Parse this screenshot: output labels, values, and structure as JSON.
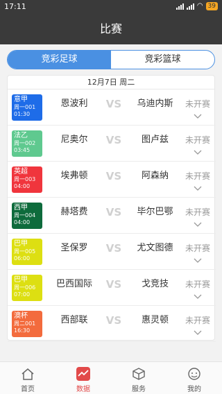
{
  "statusbar": {
    "time": "17:11",
    "battery": "39"
  },
  "header": {
    "title": "比赛"
  },
  "tabs": [
    {
      "label": "竞彩足球",
      "active": true
    },
    {
      "label": "竞彩篮球",
      "active": false
    }
  ],
  "date_label": "12月7日 周二",
  "vs_label": "VS",
  "matches": [
    {
      "league": "意甲",
      "number": "周一001",
      "time": "01:30",
      "home": "恩波利",
      "away": "乌迪内斯",
      "status": "未开赛",
      "color": "#1e6ce8"
    },
    {
      "league": "法乙",
      "number": "周一002",
      "time": "03:45",
      "home": "尼奥尔",
      "away": "图卢兹",
      "status": "未开赛",
      "color": "#5fc98f"
    },
    {
      "league": "英超",
      "number": "周一003",
      "time": "04:00",
      "home": "埃弗顿",
      "away": "阿森纳",
      "status": "未开赛",
      "color": "#f0353d"
    },
    {
      "league": "西甲",
      "number": "周一004",
      "time": "04:00",
      "home": "赫塔费",
      "away": "毕尔巴鄂",
      "status": "未开赛",
      "color": "#0e6b3c"
    },
    {
      "league": "巴甲",
      "number": "周一005",
      "time": "06:00",
      "home": "圣保罗",
      "away": "尤文图德",
      "status": "未开赛",
      "color": "#dddf12"
    },
    {
      "league": "巴甲",
      "number": "周一006",
      "time": "07:00",
      "home": "巴西国际",
      "away": "戈竞技",
      "status": "未开赛",
      "color": "#dddf12"
    },
    {
      "league": "澳杯",
      "number": "周二001",
      "time": "16:30",
      "home": "西部联",
      "away": "惠灵顿",
      "status": "未开赛",
      "color": "#f36b3d"
    }
  ],
  "bottom_nav": [
    {
      "label": "首页",
      "icon": "home-icon",
      "active": false
    },
    {
      "label": "数据",
      "icon": "chart-icon",
      "active": true
    },
    {
      "label": "服务",
      "icon": "box-icon",
      "active": false
    },
    {
      "label": "我的",
      "icon": "user-icon",
      "active": false
    }
  ]
}
